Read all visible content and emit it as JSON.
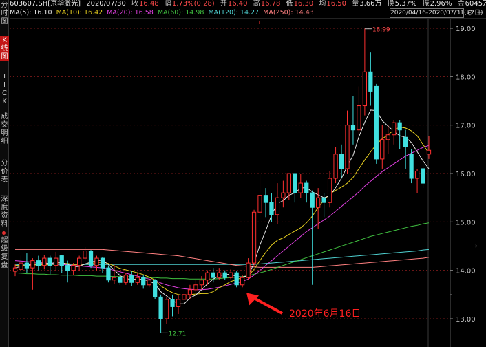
{
  "sidebar": {
    "tabs": [
      {
        "label": "分时图",
        "active": false
      },
      {
        "label": "K线图",
        "active": true
      },
      {
        "label": "TICK",
        "active": false
      },
      {
        "label": "成交明细",
        "active": false
      },
      {
        "label": "分价表",
        "active": false
      },
      {
        "label": "深度资料",
        "active": false
      },
      {
        "label": "超级复盘",
        "active": false
      }
    ]
  },
  "header": {
    "code": "603607.SH[京华激光]",
    "date": "2020/07/30",
    "close_label": "收",
    "close": "16.48",
    "change_label": "幅",
    "change": "1.73%(0.28)",
    "open_label": "开",
    "open": "16.40",
    "high_label": "高",
    "high": "16.78",
    "low_label": "低",
    "low": "16.30",
    "avg_label": "均",
    "avg": "16.50",
    "amount_label": "量",
    "amount": "3.66万",
    "turnover_label": "换",
    "turnover": "5.37%",
    "amplitude_label": "振",
    "amplitude": "2.96%",
    "value_label": "金",
    "value": "6045万"
  },
  "ma": [
    {
      "label": "MA(5): 16.10",
      "color": "#e8e8e8"
    },
    {
      "label": "MA(10): 16.42",
      "color": "#e8d020"
    },
    {
      "label": "MA(20): 16.58",
      "color": "#e040e0"
    },
    {
      "label": "MA(60): 14.98",
      "color": "#40c040"
    },
    {
      "label": "MA(120): 14.27",
      "color": "#4fd0d0"
    },
    {
      "label": "MA(250): 14.43",
      "color": "#ff8080"
    }
  ],
  "range": "2020/04/16-2020/07/31(72日)",
  "icons": {
    "settings": "gear-icon",
    "add": "plus-icon"
  },
  "annotations": {
    "high_mark": "18.99",
    "low_mark": "12.71",
    "arrow_text": "2020年6月16日"
  },
  "axis": {
    "ticks": [
      "19.00",
      "18.00",
      "17.00",
      "16.00",
      "15.00",
      "14.00",
      "13.00"
    ]
  },
  "colors": {
    "up": "#ff3030",
    "down": "#40e0e0",
    "ma5": "#e8e8e8",
    "ma10": "#e8d020",
    "ma20": "#e040e0",
    "ma60": "#40c040",
    "ma120": "#4fd0d0",
    "ma250": "#ff8080"
  },
  "chart_data": {
    "type": "candlestick",
    "ylim": [
      12.7,
      19.2
    ],
    "candles": [
      {
        "o": 13.98,
        "c": 14.05,
        "h": 14.12,
        "l": 13.88
      },
      {
        "o": 14.02,
        "c": 14.15,
        "h": 14.3,
        "l": 13.95
      },
      {
        "o": 14.15,
        "c": 14.05,
        "h": 14.35,
        "l": 13.95
      },
      {
        "o": 14.05,
        "c": 14.2,
        "h": 14.25,
        "l": 13.6
      },
      {
        "o": 14.2,
        "c": 14.1,
        "h": 14.3,
        "l": 14.0
      },
      {
        "o": 14.1,
        "c": 14.25,
        "h": 14.32,
        "l": 14.02
      },
      {
        "o": 14.25,
        "c": 14.1,
        "h": 14.3,
        "l": 13.92
      },
      {
        "o": 14.1,
        "c": 14.25,
        "h": 14.38,
        "l": 14.0
      },
      {
        "o": 14.3,
        "c": 14.1,
        "h": 14.32,
        "l": 13.95
      },
      {
        "o": 14.1,
        "c": 14.0,
        "h": 14.2,
        "l": 13.75
      },
      {
        "o": 14.0,
        "c": 14.1,
        "h": 14.15,
        "l": 13.9
      },
      {
        "o": 14.1,
        "c": 14.25,
        "h": 14.3,
        "l": 14.0
      },
      {
        "o": 14.25,
        "c": 14.4,
        "h": 14.48,
        "l": 14.2
      },
      {
        "o": 14.4,
        "c": 14.1,
        "h": 14.42,
        "l": 14.05
      },
      {
        "o": 14.1,
        "c": 14.25,
        "h": 14.3,
        "l": 14.0
      },
      {
        "o": 14.25,
        "c": 14.05,
        "h": 14.28,
        "l": 13.95
      },
      {
        "o": 14.05,
        "c": 13.8,
        "h": 14.1,
        "l": 13.75
      },
      {
        "o": 13.8,
        "c": 13.85,
        "h": 14.12,
        "l": 13.72
      },
      {
        "o": 13.85,
        "c": 13.75,
        "h": 13.95,
        "l": 13.7
      },
      {
        "o": 13.75,
        "c": 13.9,
        "h": 13.95,
        "l": 13.7
      },
      {
        "o": 13.9,
        "c": 13.75,
        "h": 13.98,
        "l": 13.68
      },
      {
        "o": 13.75,
        "c": 13.85,
        "h": 13.95,
        "l": 13.7
      },
      {
        "o": 13.85,
        "c": 13.7,
        "h": 13.9,
        "l": 13.62
      },
      {
        "o": 13.7,
        "c": 13.8,
        "h": 13.85,
        "l": 13.65
      },
      {
        "o": 13.8,
        "c": 13.45,
        "h": 13.82,
        "l": 13.4
      },
      {
        "o": 13.45,
        "c": 13.0,
        "h": 13.5,
        "l": 12.71
      },
      {
        "o": 13.0,
        "c": 13.4,
        "h": 13.45,
        "l": 12.9
      },
      {
        "o": 13.4,
        "c": 13.25,
        "h": 13.5,
        "l": 13.05
      },
      {
        "o": 13.25,
        "c": 13.4,
        "h": 13.5,
        "l": 13.1
      },
      {
        "o": 13.4,
        "c": 13.5,
        "h": 13.6,
        "l": 13.3
      },
      {
        "o": 13.5,
        "c": 13.6,
        "h": 13.7,
        "l": 13.4
      },
      {
        "o": 13.6,
        "c": 13.7,
        "h": 13.8,
        "l": 13.55
      },
      {
        "o": 13.7,
        "c": 13.8,
        "h": 13.88,
        "l": 13.6
      },
      {
        "o": 13.8,
        "c": 13.95,
        "h": 14.0,
        "l": 13.7
      },
      {
        "o": 13.95,
        "c": 13.85,
        "h": 14.05,
        "l": 13.75
      },
      {
        "o": 13.85,
        "c": 13.95,
        "h": 14.05,
        "l": 13.8
      },
      {
        "o": 13.95,
        "c": 13.85,
        "h": 14.0,
        "l": 13.8
      },
      {
        "o": 13.85,
        "c": 13.95,
        "h": 14.02,
        "l": 13.82
      },
      {
        "o": 13.95,
        "c": 13.7,
        "h": 13.98,
        "l": 13.65
      },
      {
        "o": 13.7,
        "c": 13.85,
        "h": 13.9,
        "l": 13.65
      },
      {
        "o": 13.85,
        "c": 14.15,
        "h": 14.25,
        "l": 13.8
      },
      {
        "o": 14.15,
        "c": 15.2,
        "h": 15.25,
        "l": 14.1
      },
      {
        "o": 15.2,
        "c": 15.55,
        "h": 16.0,
        "l": 15.1
      },
      {
        "o": 15.55,
        "c": 15.4,
        "h": 15.7,
        "l": 15.1
      },
      {
        "o": 15.4,
        "c": 15.15,
        "h": 15.6,
        "l": 15.0
      },
      {
        "o": 15.15,
        "c": 15.5,
        "h": 15.8,
        "l": 14.95
      },
      {
        "o": 15.5,
        "c": 15.6,
        "h": 15.85,
        "l": 15.3
      },
      {
        "o": 15.6,
        "c": 16.0,
        "h": 16.0,
        "l": 15.45
      },
      {
        "o": 16.0,
        "c": 15.6,
        "h": 16.0,
        "l": 15.4
      },
      {
        "o": 15.6,
        "c": 15.8,
        "h": 16.0,
        "l": 15.5
      },
      {
        "o": 15.8,
        "c": 15.6,
        "h": 15.85,
        "l": 15.4
      },
      {
        "o": 15.6,
        "c": 15.3,
        "h": 15.65,
        "l": 13.7
      },
      {
        "o": 15.3,
        "c": 15.5,
        "h": 15.7,
        "l": 14.85
      },
      {
        "o": 15.5,
        "c": 15.4,
        "h": 15.6,
        "l": 15.1
      },
      {
        "o": 15.4,
        "c": 15.9,
        "h": 16.05,
        "l": 15.3
      },
      {
        "o": 15.9,
        "c": 16.4,
        "h": 16.55,
        "l": 15.8
      },
      {
        "o": 16.4,
        "c": 16.1,
        "h": 16.6,
        "l": 15.9
      },
      {
        "o": 16.1,
        "c": 17.0,
        "h": 17.3,
        "l": 16.0
      },
      {
        "o": 17.0,
        "c": 16.9,
        "h": 17.6,
        "l": 16.6
      },
      {
        "o": 16.9,
        "c": 17.4,
        "h": 17.8,
        "l": 16.8
      },
      {
        "o": 17.4,
        "c": 18.1,
        "h": 18.99,
        "l": 17.2
      },
      {
        "o": 18.1,
        "c": 17.7,
        "h": 18.5,
        "l": 17.4
      },
      {
        "o": 17.8,
        "c": 16.3,
        "h": 17.85,
        "l": 16.2
      },
      {
        "o": 16.3,
        "c": 16.7,
        "h": 17.0,
        "l": 16.1
      },
      {
        "o": 16.7,
        "c": 16.8,
        "h": 17.0,
        "l": 16.4
      },
      {
        "o": 16.8,
        "c": 17.05,
        "h": 17.1,
        "l": 16.6
      },
      {
        "o": 17.05,
        "c": 16.9,
        "h": 17.1,
        "l": 16.5
      },
      {
        "o": 16.75,
        "c": 16.55,
        "h": 16.9,
        "l": 16.1
      },
      {
        "o": 16.4,
        "c": 15.9,
        "h": 16.5,
        "l": 15.8
      },
      {
        "o": 15.9,
        "c": 16.05,
        "h": 16.1,
        "l": 15.6
      },
      {
        "o": 16.1,
        "c": 15.8,
        "h": 16.2,
        "l": 15.7
      },
      {
        "o": 16.4,
        "c": 16.48,
        "h": 16.78,
        "l": 16.3
      }
    ],
    "ma5": [
      14.05,
      14.08,
      14.1,
      14.12,
      14.15,
      14.15,
      14.14,
      14.16,
      14.16,
      14.12,
      14.07,
      14.08,
      14.13,
      14.17,
      14.2,
      14.21,
      14.12,
      14.01,
      13.89,
      13.83,
      13.81,
      13.82,
      13.81,
      13.78,
      13.72,
      13.56,
      13.47,
      13.38,
      13.31,
      13.31,
      13.43,
      13.49,
      13.6,
      13.72,
      13.82,
      13.89,
      13.91,
      13.92,
      13.87,
      13.86,
      13.89,
      14.15,
      14.52,
      14.82,
      15.14,
      15.38,
      15.44,
      15.55,
      15.6,
      15.7,
      15.71,
      15.62,
      15.56,
      15.5,
      15.54,
      15.71,
      15.9,
      16.15,
      16.38,
      16.76,
      17.06,
      17.31,
      17.3,
      17.09,
      16.98,
      16.87,
      16.78,
      16.75,
      16.64,
      16.45,
      16.26,
      16.1
    ],
    "ma10": [
      14.1,
      14.1,
      14.1,
      14.11,
      14.11,
      14.11,
      14.12,
      14.13,
      14.14,
      14.14,
      14.12,
      14.12,
      14.13,
      14.14,
      14.16,
      14.17,
      14.14,
      14.09,
      14.04,
      14.01,
      13.98,
      13.95,
      13.91,
      13.86,
      13.8,
      13.68,
      13.6,
      13.54,
      13.5,
      13.48,
      13.5,
      13.51,
      13.52,
      13.52,
      13.56,
      13.64,
      13.7,
      13.77,
      13.81,
      13.85,
      13.89,
      14.02,
      14.2,
      14.37,
      14.52,
      14.62,
      14.67,
      14.74,
      14.81,
      14.88,
      14.98,
      15.12,
      15.3,
      15.45,
      15.58,
      15.65,
      15.72,
      15.8,
      15.92,
      16.1,
      16.28,
      16.45,
      16.6,
      16.72,
      16.8,
      16.9,
      16.96,
      16.94,
      16.88,
      16.78,
      16.6,
      16.42
    ],
    "ma20": [
      14.2,
      14.19,
      14.18,
      14.17,
      14.16,
      14.15,
      14.14,
      14.13,
      14.12,
      14.11,
      14.1,
      14.09,
      14.08,
      14.07,
      14.06,
      14.05,
      14.03,
      14.0,
      13.97,
      13.94,
      13.91,
      13.88,
      13.85,
      13.82,
      13.79,
      13.74,
      13.7,
      13.67,
      13.64,
      13.62,
      13.61,
      13.6,
      13.6,
      13.61,
      13.63,
      13.65,
      13.68,
      13.71,
      13.74,
      13.77,
      13.82,
      13.9,
      14.0,
      14.1,
      14.2,
      14.3,
      14.4,
      14.5,
      14.6,
      14.7,
      14.8,
      14.88,
      14.96,
      15.04,
      15.12,
      15.22,
      15.32,
      15.42,
      15.52,
      15.62,
      15.74,
      15.84,
      15.94,
      16.04,
      16.12,
      16.2,
      16.28,
      16.36,
      16.42,
      16.48,
      16.54,
      16.58
    ],
    "ma60": [
      13.95,
      13.94,
      13.93,
      13.93,
      13.92,
      13.92,
      13.91,
      13.91,
      13.9,
      13.9,
      13.9,
      13.89,
      13.89,
      13.89,
      13.88,
      13.88,
      13.88,
      13.87,
      13.87,
      13.87,
      13.86,
      13.86,
      13.86,
      13.85,
      13.85,
      13.84,
      13.84,
      13.83,
      13.83,
      13.83,
      13.82,
      13.82,
      13.82,
      13.82,
      13.82,
      13.83,
      13.84,
      13.85,
      13.86,
      13.87,
      13.89,
      13.92,
      13.95,
      13.98,
      14.02,
      14.06,
      14.1,
      14.14,
      14.18,
      14.22,
      14.26,
      14.3,
      14.34,
      14.38,
      14.42,
      14.46,
      14.5,
      14.54,
      14.58,
      14.62,
      14.66,
      14.7,
      14.73,
      14.76,
      14.79,
      14.82,
      14.85,
      14.88,
      14.91,
      14.93,
      14.96,
      14.98
    ],
    "ma120": [
      14.43,
      14.43,
      14.43,
      14.43,
      14.43,
      14.43,
      14.43,
      14.43,
      14.43,
      14.43,
      14.43,
      14.43,
      14.43,
      14.43,
      14.43,
      14.43,
      14.42,
      14.41,
      14.4,
      14.39,
      14.38,
      14.37,
      14.36,
      14.35,
      14.34,
      14.33,
      14.32,
      14.31,
      14.3,
      14.28,
      14.26,
      14.24,
      14.22,
      14.2,
      14.18,
      14.16,
      14.14,
      14.12,
      14.1,
      14.09,
      14.08,
      14.07,
      14.06,
      14.06,
      14.06,
      14.06,
      14.06,
      14.06,
      14.06,
      14.06,
      14.06,
      14.06,
      14.07,
      14.08,
      14.09,
      14.1,
      14.11,
      14.12,
      14.13,
      14.14,
      14.15,
      14.16,
      14.17,
      14.18,
      14.19,
      14.2,
      14.21,
      14.22,
      14.23,
      14.24,
      14.25,
      14.27
    ],
    "ma250": [
      14.11,
      14.12,
      14.12,
      14.12,
      14.12,
      14.12,
      14.12,
      14.12,
      14.12,
      14.12,
      14.12,
      14.12,
      14.12,
      14.12,
      14.12,
      14.12,
      14.12,
      14.12,
      14.12,
      14.12,
      14.12,
      14.12,
      14.12,
      14.12,
      14.12,
      14.12,
      14.12,
      14.12,
      14.12,
      14.12,
      14.12,
      14.12,
      14.12,
      14.12,
      14.12,
      14.12,
      14.12,
      14.12,
      14.12,
      14.12,
      14.12,
      14.12,
      14.13,
      14.14,
      14.15,
      14.16,
      14.17,
      14.18,
      14.19,
      14.2,
      14.21,
      14.22,
      14.23,
      14.24,
      14.25,
      14.26,
      14.27,
      14.28,
      14.29,
      14.3,
      14.31,
      14.32,
      14.33,
      14.34,
      14.35,
      14.36,
      14.37,
      14.38,
      14.39,
      14.4,
      14.42,
      14.43
    ],
    "arrow_index": 39,
    "high_index": 60,
    "low_index": 25
  }
}
